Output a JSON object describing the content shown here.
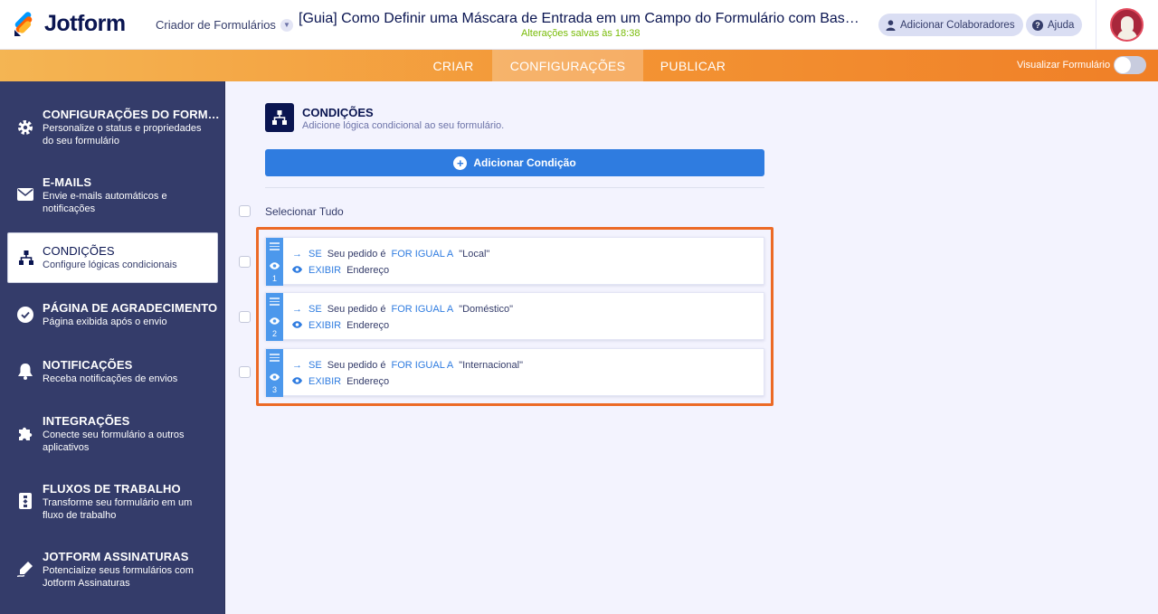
{
  "header": {
    "logo_text": "Jotform",
    "builder_label": "Criador de Formulários",
    "form_title": "[Guia] Como Definir uma Máscara de Entrada em um Campo do Formulário com Bas…",
    "saved_status": "Alterações salvas às 18:38",
    "collab_label": "Adicionar Colaboradores",
    "help_label": "Ajuda"
  },
  "nav": {
    "tabs": [
      "CRIAR",
      "CONFIGURAÇÕES",
      "PUBLICAR"
    ],
    "active_tab": "CONFIGURAÇÕES",
    "preview_label": "Visualizar Formulário",
    "preview_on": false
  },
  "sidebar": {
    "items": [
      {
        "icon": "gear-icon",
        "title": "CONFIGURAÇÕES DO FORM…",
        "desc": "Personalize o status e propriedades do seu formulário"
      },
      {
        "icon": "envelope-icon",
        "title": "E-MAILS",
        "desc": "Envie e-mails automáticos e notificações"
      },
      {
        "icon": "sitemap-icon",
        "title": "CONDIÇÕES",
        "desc": "Configure lógicas condicionais"
      },
      {
        "icon": "check-circle-icon",
        "title": "PÁGINA DE AGRADECIMENTO",
        "desc": "Página exibida após o envio"
      },
      {
        "icon": "bell-icon",
        "title": "NOTIFICAÇÕES",
        "desc": "Receba notificações de envios"
      },
      {
        "icon": "puzzle-icon",
        "title": "INTEGRAÇÕES",
        "desc": "Conecte seu formulário a outros aplicativos"
      },
      {
        "icon": "workflow-icon",
        "title": "FLUXOS DE TRABALHO",
        "desc": "Transforme seu formulário em um fluxo de trabalho"
      },
      {
        "icon": "signature-pen-icon",
        "title": "JOTFORM ASSINATURAS",
        "desc": "Potencialize seus formulários com Jotform Assinaturas"
      }
    ],
    "active_index": 2
  },
  "main": {
    "title": "CONDIÇÕES",
    "subtitle": "Adicione lógica condicional ao seu formulário.",
    "add_button": "Adicionar Condição",
    "select_all": "Selecionar Tudo",
    "conditions": [
      {
        "number": "1",
        "if_kw": "SE",
        "field": "Seu pedido é",
        "operator": "FOR IGUAL A",
        "value": "\"Local\"",
        "action_kw": "EXIBIR",
        "target": "Endereço"
      },
      {
        "number": "2",
        "if_kw": "SE",
        "field": "Seu pedido é",
        "operator": "FOR IGUAL A",
        "value": "\"Doméstico\"",
        "action_kw": "EXIBIR",
        "target": "Endereço"
      },
      {
        "number": "3",
        "if_kw": "SE",
        "field": "Seu pedido é",
        "operator": "FOR IGUAL A",
        "value": "\"Internacional\"",
        "action_kw": "EXIBIR",
        "target": "Endereço"
      }
    ]
  },
  "colors": {
    "highlight": "#ec6a26",
    "accent": "#2f7ce0",
    "sidebar": "#343c6a"
  }
}
